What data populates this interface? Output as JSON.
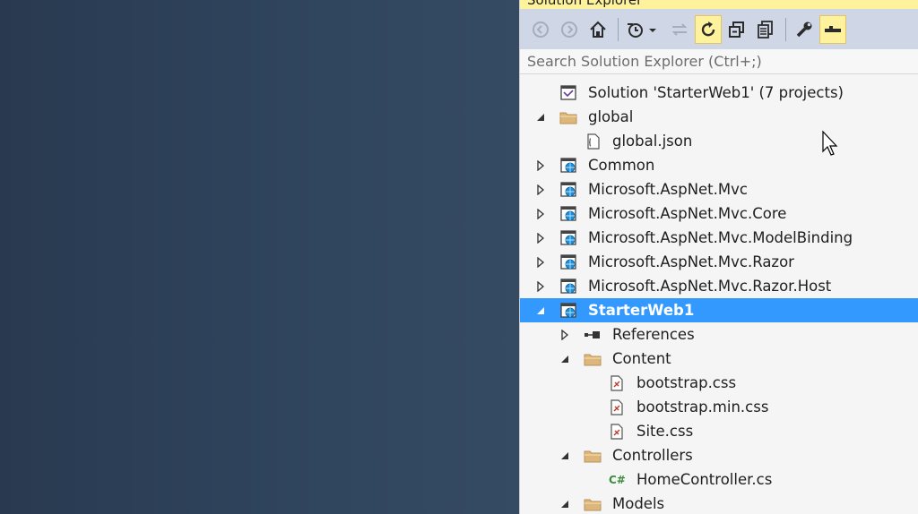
{
  "panel": {
    "title": "Solution Explorer",
    "search_placeholder": "Search Solution Explorer (Ctrl+;)"
  },
  "toolbar": {
    "buttons": [
      "back-icon",
      "forward-icon",
      "home-icon",
      "history-icon",
      "sync-icon",
      "refresh-icon",
      "collapse-all-icon",
      "show-all-files-icon",
      "properties-icon",
      "preview-icon"
    ]
  },
  "tree": {
    "items": [
      {
        "label": "Solution 'StarterWeb1' (7 projects)",
        "icon": "solution-icon",
        "level": 0,
        "expander": "none"
      },
      {
        "label": "global",
        "icon": "folder-icon",
        "level": 0,
        "expander": "expanded"
      },
      {
        "label": "global.json",
        "icon": "json-file-icon",
        "level": 1,
        "expander": "none"
      },
      {
        "label": "Common",
        "icon": "web-project-icon",
        "level": 0,
        "expander": "collapsed"
      },
      {
        "label": "Microsoft.AspNet.Mvc",
        "icon": "web-project-icon",
        "level": 0,
        "expander": "collapsed"
      },
      {
        "label": "Microsoft.AspNet.Mvc.Core",
        "icon": "web-project-icon",
        "level": 0,
        "expander": "collapsed"
      },
      {
        "label": "Microsoft.AspNet.Mvc.ModelBinding",
        "icon": "web-project-icon",
        "level": 0,
        "expander": "collapsed"
      },
      {
        "label": "Microsoft.AspNet.Mvc.Razor",
        "icon": "web-project-icon",
        "level": 0,
        "expander": "collapsed"
      },
      {
        "label": "Microsoft.AspNet.Mvc.Razor.Host",
        "icon": "web-project-icon",
        "level": 0,
        "expander": "collapsed"
      },
      {
        "label": "StarterWeb1",
        "icon": "web-project-icon",
        "level": 0,
        "expander": "expanded",
        "selected": true
      },
      {
        "label": "References",
        "icon": "references-icon",
        "level": 1,
        "expander": "collapsed"
      },
      {
        "label": "Content",
        "icon": "folder-icon",
        "level": 1,
        "expander": "expanded"
      },
      {
        "label": "bootstrap.css",
        "icon": "css-file-icon",
        "level": 2,
        "expander": "none"
      },
      {
        "label": "bootstrap.min.css",
        "icon": "css-file-icon",
        "level": 2,
        "expander": "none"
      },
      {
        "label": "Site.css",
        "icon": "css-file-icon",
        "level": 2,
        "expander": "none"
      },
      {
        "label": "Controllers",
        "icon": "folder-icon",
        "level": 1,
        "expander": "expanded"
      },
      {
        "label": "HomeController.cs",
        "icon": "csharp-file-icon",
        "level": 2,
        "expander": "none"
      },
      {
        "label": "Models",
        "icon": "folder-icon",
        "level": 1,
        "expander": "expanded"
      }
    ]
  },
  "colors": {
    "selection": "#3399ff",
    "toolbar": "#cfd6e5",
    "active_tab": "#fff29d",
    "editor_background": "#2f4158"
  }
}
